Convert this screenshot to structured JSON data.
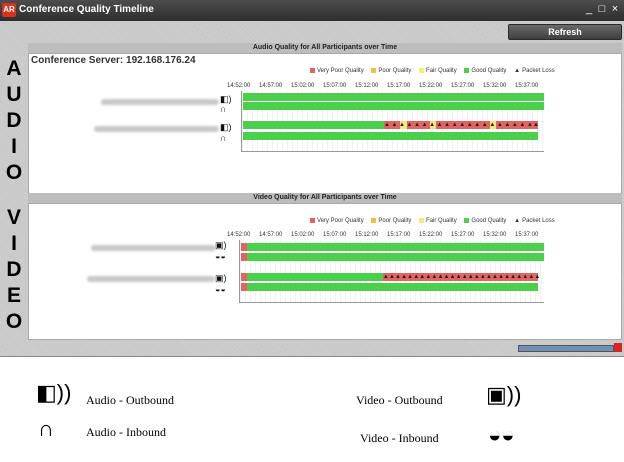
{
  "window": {
    "app_icon": "AR",
    "title": "Conference Quality Timeline",
    "controls": [
      "_",
      "□",
      "×"
    ]
  },
  "toolbar": {
    "refresh_label": "Refresh"
  },
  "side_labels": {
    "audio": [
      "A",
      "U",
      "D",
      "I",
      "O"
    ],
    "video": [
      "V",
      "I",
      "D",
      "E",
      "O"
    ]
  },
  "colors": {
    "very_poor": "#e06464",
    "poor": "#f0c040",
    "fair": "#f5ea7a",
    "good": "#4ccf4c",
    "packet_loss": "#222222"
  },
  "audio": {
    "header": "Audio Quality for All Participants over Time",
    "server": "Conference Server: 192.168.176.24",
    "legend": [
      "Very Poor Quality",
      "Poor Quality",
      "Fair Quality",
      "Good Quality",
      "Packet Loss"
    ],
    "ticks": [
      "14:52:00",
      "14:57:00",
      "15:02:00",
      "15:07:00",
      "15:12:00",
      "15:17:00",
      "15:22:00",
      "15:27:00",
      "15:32:00",
      "15:37:00"
    ],
    "participants": [
      {
        "outbound": [
          {
            "q": "good",
            "from": 0,
            "to": 1
          }
        ],
        "inbound": [
          {
            "q": "good",
            "from": 0,
            "to": 1
          }
        ],
        "loss": []
      },
      {
        "outbound": [
          {
            "q": "good",
            "from": 0,
            "to": 0.47
          },
          {
            "q": "very_poor",
            "from": 0.47,
            "to": 0.52
          },
          {
            "q": "fair",
            "from": 0.52,
            "to": 0.545
          },
          {
            "q": "very_poor",
            "from": 0.545,
            "to": 0.62
          },
          {
            "q": "fair",
            "from": 0.62,
            "to": 0.64
          },
          {
            "q": "very_poor",
            "from": 0.64,
            "to": 0.82
          },
          {
            "q": "fair",
            "from": 0.82,
            "to": 0.84
          },
          {
            "q": "very_poor",
            "from": 0.84,
            "to": 0.98
          }
        ],
        "inbound": [
          {
            "q": "good",
            "from": 0,
            "to": 0.98
          }
        ],
        "loss": [
          0.475,
          0.5,
          0.525,
          0.55,
          0.575,
          0.6,
          0.625,
          0.65,
          0.675,
          0.7,
          0.725,
          0.75,
          0.775,
          0.8,
          0.825,
          0.85,
          0.875,
          0.9,
          0.925,
          0.95,
          0.97
        ]
      }
    ]
  },
  "video": {
    "header": "Video Quality for All Participants over Time",
    "legend": [
      "Very Poor Quality",
      "Poor Quality",
      "Fair Quality",
      "Good Quality",
      "Packet Loss"
    ],
    "ticks": [
      "14:52:00",
      "14:57:00",
      "15:02:00",
      "15:07:00",
      "15:12:00",
      "15:17:00",
      "15:22:00",
      "15:27:00",
      "15:32:00",
      "15:37:00"
    ],
    "participants": [
      {
        "outbound": [
          {
            "q": "very_poor",
            "from": 0,
            "to": 0.02
          },
          {
            "q": "good",
            "from": 0.02,
            "to": 1
          }
        ],
        "inbound": [
          {
            "q": "very_poor",
            "from": 0,
            "to": 0.02
          },
          {
            "q": "good",
            "from": 0.02,
            "to": 1
          }
        ],
        "loss": []
      },
      {
        "outbound": [
          {
            "q": "very_poor",
            "from": 0,
            "to": 0.02
          },
          {
            "q": "good",
            "from": 0.02,
            "to": 0.47
          },
          {
            "q": "very_poor",
            "from": 0.47,
            "to": 0.98
          }
        ],
        "inbound": [
          {
            "q": "very_poor",
            "from": 0,
            "to": 0.02
          },
          {
            "q": "good",
            "from": 0.02,
            "to": 0.98
          }
        ],
        "loss": [
          0.475,
          0.495,
          0.515,
          0.535,
          0.555,
          0.575,
          0.595,
          0.615,
          0.635,
          0.655,
          0.675,
          0.695,
          0.715,
          0.735,
          0.755,
          0.775,
          0.795,
          0.815,
          0.835,
          0.855,
          0.875,
          0.895,
          0.915,
          0.935,
          0.955,
          0.975
        ]
      }
    ]
  },
  "key": {
    "audio_out": "Audio - Outbound",
    "audio_in": "Audio - Inbound",
    "video_out": "Video - Outbound",
    "video_in": "Video - Inbound"
  }
}
